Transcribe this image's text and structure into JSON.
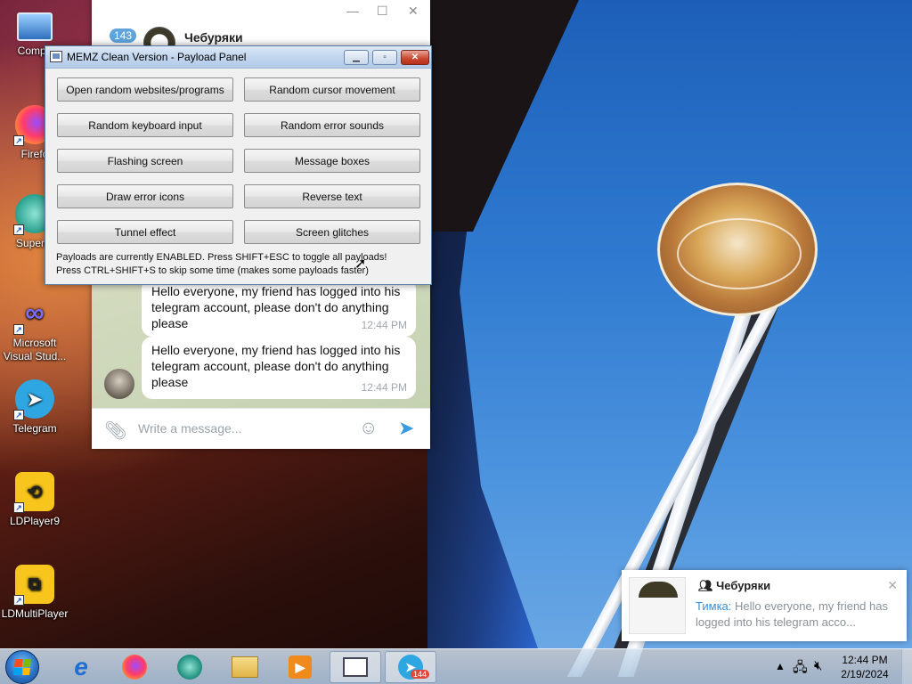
{
  "desktop": {
    "icons": [
      {
        "label": "Compu",
        "icon": "computer-icon"
      },
      {
        "label": "Firefo",
        "icon": "firefox-icon"
      },
      {
        "label": "Superm",
        "icon": "supermium-icon"
      },
      {
        "label": "Microsoft Visual Stud...",
        "icon": "visual-studio-icon"
      },
      {
        "label": "Telegram",
        "icon": "telegram-icon"
      },
      {
        "label": "LDPlayer9",
        "icon": "ldplayer-icon"
      },
      {
        "label": "LDMultiPlayer",
        "icon": "ldmultiplayer-icon"
      }
    ]
  },
  "telegram": {
    "unread_badge": "143",
    "chat_name": "Чебуряки",
    "messages": [
      {
        "text": "Hello everyone, my friend has logged into his telegram account, please don't do anything please",
        "time": "12:44 PM"
      },
      {
        "text": "Hello everyone, my friend has logged into his telegram account, please don't do anything please",
        "time": "12:44 PM"
      }
    ],
    "input_placeholder": "Write a message..."
  },
  "memz": {
    "title": "MEMZ Clean Version - Payload Panel",
    "buttons": [
      "Open random websites/programs",
      "Random cursor movement",
      "Random keyboard input",
      "Random error sounds",
      "Flashing screen",
      "Message boxes",
      "Draw error icons",
      "Reverse text",
      "Tunnel effect",
      "Screen glitches"
    ],
    "status_line1": "Payloads are currently ENABLED. Press SHIFT+ESC to toggle all payloads!",
    "status_line2": "Press CTRL+SHIFT+S to skip some time (makes some payloads faster)"
  },
  "notification": {
    "group": "Чебуряки",
    "sender": "Тимка:",
    "text": "Hello everyone, my friend has logged into his telegram acco..."
  },
  "taskbar": {
    "telegram_badge": "144",
    "time": "12:44 PM",
    "date": "2/19/2024"
  },
  "colors": {
    "telegram_accent": "#3a9ce0",
    "badge_blue": "#5fa4dc",
    "close_red": "#c8452e"
  }
}
